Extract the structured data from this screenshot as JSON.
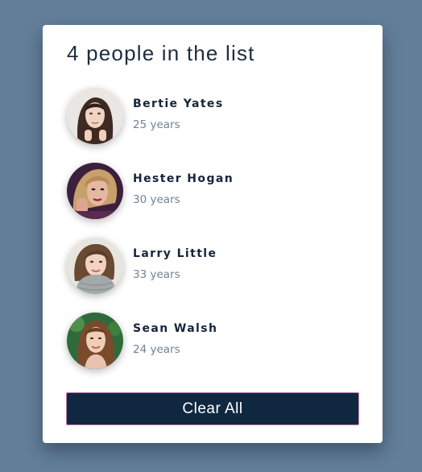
{
  "header": {
    "title": "4 people in the list"
  },
  "people": [
    {
      "name": "Bertie Yates",
      "age": "25 years",
      "avatar": "portrait-photo"
    },
    {
      "name": "Hester Hogan",
      "age": "30 years",
      "avatar": "portrait-photo"
    },
    {
      "name": "Larry Little",
      "age": "33 years",
      "avatar": "portrait-photo"
    },
    {
      "name": "Sean Walsh",
      "age": "24 years",
      "avatar": "portrait-photo"
    }
  ],
  "actions": {
    "clear_label": "Clear All"
  },
  "colors": {
    "background": "#637e99",
    "card": "#ffffff",
    "button": "#0f2840",
    "button_border": "#c27bb0",
    "name_text": "#16253a",
    "age_text": "#6f8296"
  }
}
